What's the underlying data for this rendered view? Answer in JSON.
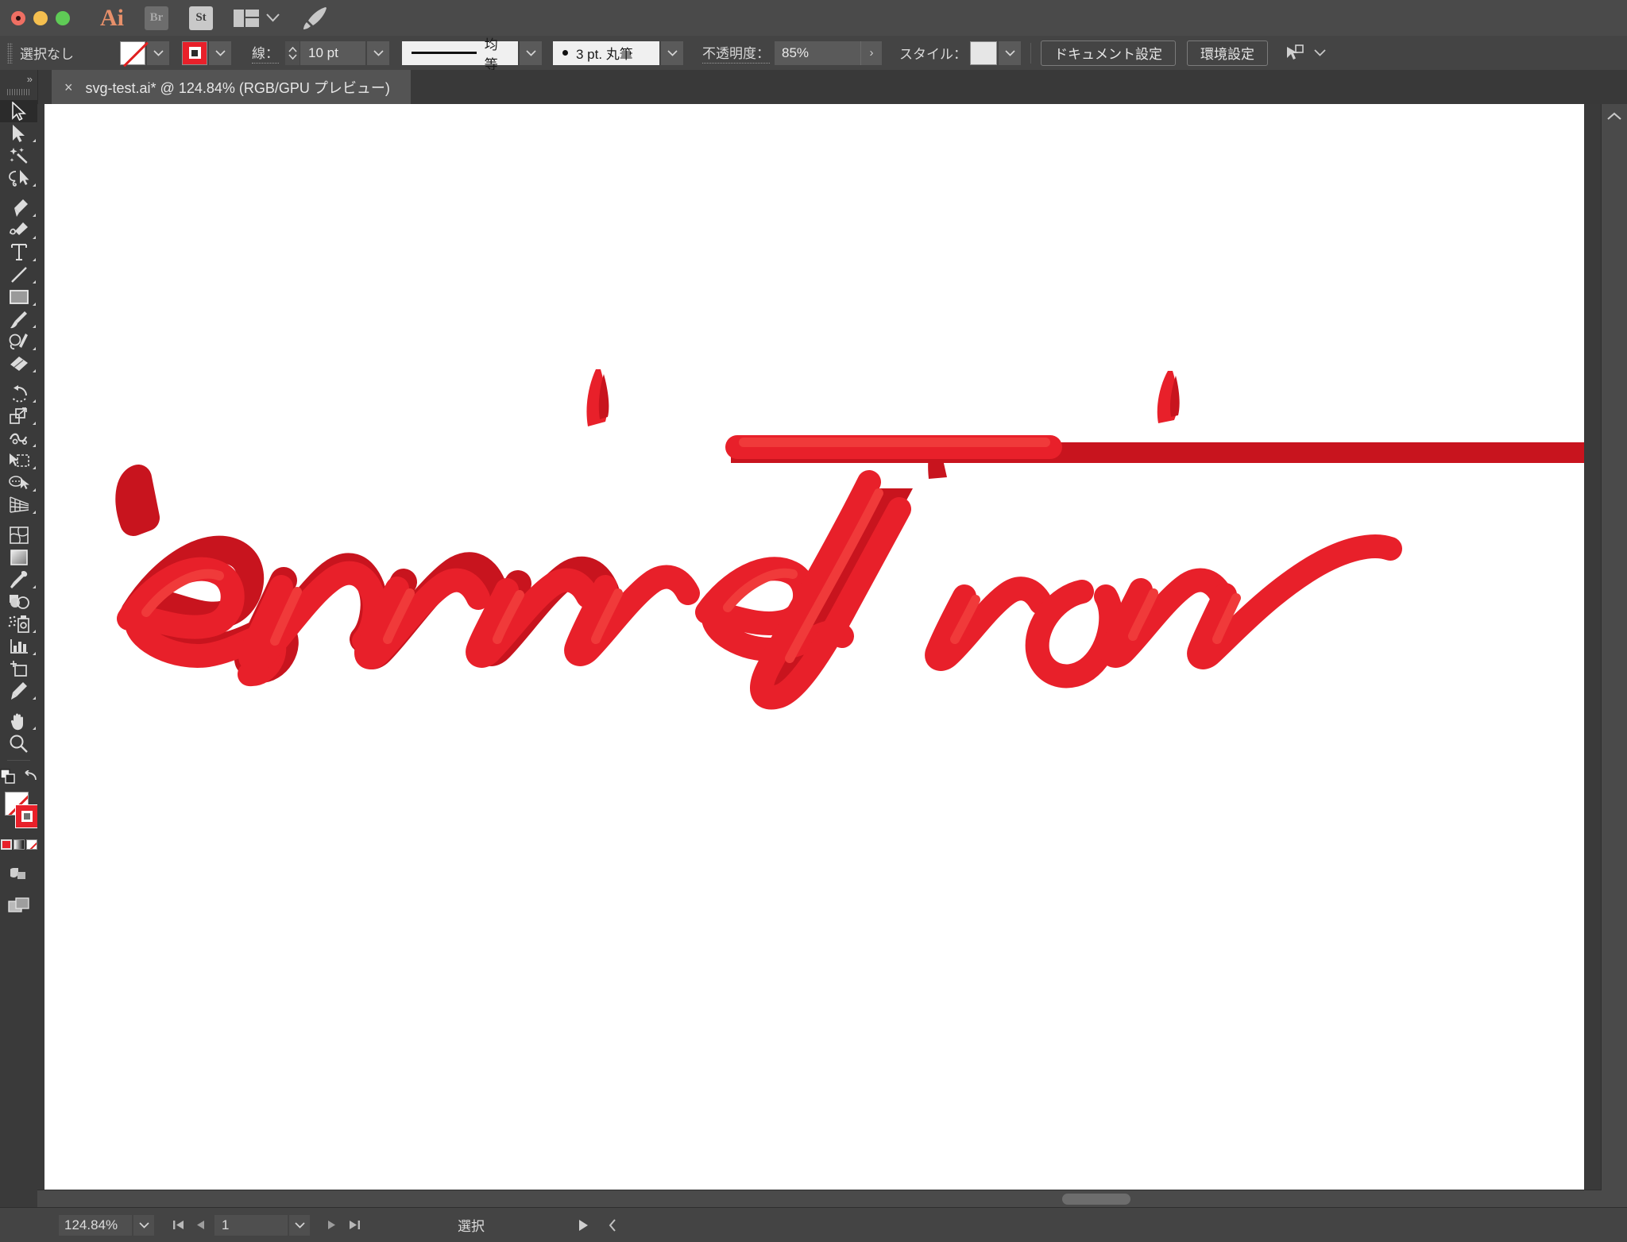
{
  "window": {
    "traffic_lights": [
      "close",
      "minimize",
      "zoom"
    ],
    "app_logo": "Ai",
    "bridge_label": "Br",
    "stock_label": "St",
    "arrange_icon": "arrange-documents-icon",
    "rocket_icon": "rocket-icon"
  },
  "control_bar": {
    "selection_status": "選択なし",
    "fill_swatch": "none",
    "stroke_swatch_color": "#e8202a",
    "stroke_label": "線：",
    "stroke_weight": "10 pt",
    "stroke_profile": "均等",
    "brush_definition": "3 pt. 丸筆",
    "opacity_label": "不透明度：",
    "opacity_value": "85%",
    "style_label": "スタイル：",
    "document_setup_button": "ドキュメント設定",
    "preferences_button": "環境設定",
    "select_similar_icon": "select-similar-objects-icon"
  },
  "tab": {
    "close_glyph": "×",
    "title": "svg-test.ai* @ 124.84% (RGB/GPU プレビュー)"
  },
  "toolbar": {
    "collapse_glyph": "»",
    "tools": [
      {
        "name": "selection-tool",
        "selected": true
      },
      {
        "name": "direct-selection-tool",
        "selected": false
      },
      {
        "name": "magic-wand-tool",
        "selected": false
      },
      {
        "name": "lasso-tool",
        "selected": false
      },
      {
        "name": "pen-tool",
        "selected": false
      },
      {
        "name": "curvature-tool",
        "selected": false
      },
      {
        "name": "type-tool",
        "selected": false
      },
      {
        "name": "line-segment-tool",
        "selected": false
      },
      {
        "name": "rectangle-tool",
        "selected": false
      },
      {
        "name": "paintbrush-tool",
        "selected": false
      },
      {
        "name": "blob-brush-tool",
        "selected": false
      },
      {
        "name": "eraser-tool",
        "selected": false
      },
      {
        "name": "rotate-tool",
        "selected": false
      },
      {
        "name": "scale-tool",
        "selected": false
      },
      {
        "name": "width-tool",
        "selected": false
      },
      {
        "name": "free-transform-tool",
        "selected": false
      },
      {
        "name": "shape-builder-tool",
        "selected": false
      },
      {
        "name": "perspective-grid-tool",
        "selected": false
      },
      {
        "name": "mesh-tool",
        "selected": false
      },
      {
        "name": "gradient-tool",
        "selected": false
      },
      {
        "name": "eyedropper-tool",
        "selected": false
      },
      {
        "name": "blend-tool",
        "selected": false
      },
      {
        "name": "symbol-sprayer-tool",
        "selected": false
      },
      {
        "name": "column-graph-tool",
        "selected": false
      },
      {
        "name": "artboard-tool",
        "selected": false
      },
      {
        "name": "slice-tool",
        "selected": false
      },
      {
        "name": "hand-tool",
        "selected": false
      },
      {
        "name": "zoom-tool",
        "selected": false
      }
    ],
    "fill_state": "none",
    "stroke_color": "#e8202a",
    "color_modes": [
      "color",
      "gradient",
      "none"
    ],
    "drawing_mode_icon": "draw-normal-icon",
    "screen_mode_icon": "change-screen-mode-icon"
  },
  "canvas": {
    "artwork_text": "animation",
    "artwork_color": "#e8202a",
    "artwork_shadow_color": "#c8141e",
    "background": "#ffffff"
  },
  "status_bar": {
    "zoom_value": "124.84%",
    "artboard_number": "1",
    "status_text": "選択",
    "first_artboard_icon": "first-artboard-icon",
    "prev_artboard_icon": "previous-artboard-icon",
    "next_artboard_icon": "next-artboard-icon",
    "last_artboard_icon": "last-artboard-icon",
    "play_icon": "play-icon",
    "chevron_left_icon": "chevron-left-icon"
  }
}
